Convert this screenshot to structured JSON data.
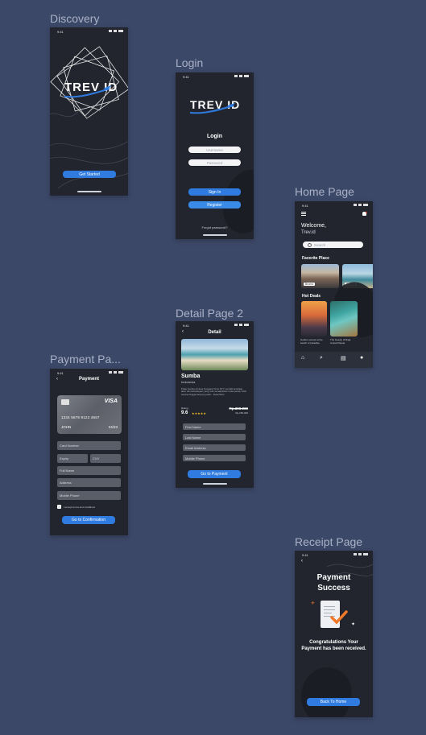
{
  "frames": {
    "discovery": {
      "label": "Discovery",
      "status_time": "9:41",
      "logo_text": "TREV ID",
      "cta": "Get Started"
    },
    "login": {
      "label": "Login",
      "status_time": "9:41",
      "logo_text": "TREV ID",
      "title": "Login",
      "username_placeholder": "Username",
      "password_placeholder": "Password",
      "sign_in": "Sign In",
      "register": "Register",
      "forgot": "Forgot password?"
    },
    "home": {
      "label": "Home Page",
      "status_time": "9:41",
      "welcome": "Welcome,",
      "app_name": "Trev.id",
      "search_placeholder": "Search",
      "favorite_title": "Favorite Place",
      "favorites": [
        "Bromo",
        "Sumba"
      ],
      "hot_deals_title": "Hot Deals",
      "deals": [
        "Golden sunset at the beach of paradise",
        "The beauty of Raja Ampat Papua"
      ]
    },
    "detail": {
      "label": "Detail Page 2",
      "status_time": "9:41",
      "title": "Detail",
      "place": "Sumba",
      "country": "Indonesia",
      "description": "Pulau Sumba di Nusa Tenggara Timur NTT memiliki landskap alam dan kebudayaan yang unik menakjubkan mulai pantai, bukit savana hingga kampung adat... Read More",
      "rating_label": "Rating",
      "rating": "9.6",
      "stars": "★★★★★",
      "old_price": "Rp.300.000",
      "price": "Rp.250.000",
      "per": "/ 1 person",
      "fields": [
        "First Name",
        "Last Name",
        "Email Address",
        "Mobile Phone"
      ],
      "cta": "Go to Payment"
    },
    "payment": {
      "label": "Payment Pa...",
      "status_time": "9:41",
      "title": "Payment",
      "card_brand": "VISA",
      "card_number": "1234 5678 9123 4567",
      "card_holder": "JOHN",
      "card_expiry": "24/23",
      "fields": [
        "Card Number",
        "Expiry",
        "CVV",
        "Full Name",
        "Address",
        "Mobile Phone"
      ],
      "terms": "I accept terms and conditions",
      "cta": "Go to Confirmation"
    },
    "receipt": {
      "label": "Receipt Page",
      "status_time": "9:41",
      "title_line1": "Payment",
      "title_line2": "Success",
      "message": "Congratulations Your Payment has been received.",
      "cta": "Back To Home"
    }
  },
  "colors": {
    "background": "#3c4868",
    "screen": "#22252e",
    "accent": "#2f7be0"
  }
}
